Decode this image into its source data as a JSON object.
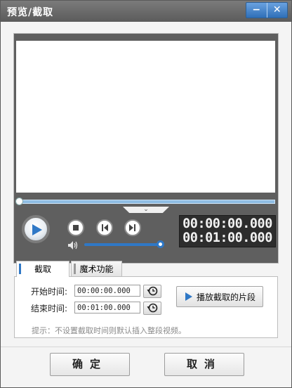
{
  "window": {
    "title": "预览/截取",
    "minimize_label": "−",
    "close_label": "✕"
  },
  "player": {
    "progress": 0,
    "collapse_glyph": "⌄",
    "current_time": "00:00:00.000",
    "total_time": "00:01:00.000",
    "volume_level": 1.0,
    "accent_color": "#2f78c6"
  },
  "tabs": [
    {
      "label": "截取",
      "active": true
    },
    {
      "label": "魔术功能",
      "active": false
    }
  ],
  "clip": {
    "start_label": "开始时间:",
    "start_value": "00:00:00.000",
    "end_label": "结束时间:",
    "end_value": "00:01:00.000",
    "set_icon": "clock-reset-icon",
    "play_segment_label": "播放截取的片段",
    "hint": "提示：不设置截取时间则默认插入整段视频。"
  },
  "footer": {
    "ok_label": "确定",
    "cancel_label": "取消"
  }
}
